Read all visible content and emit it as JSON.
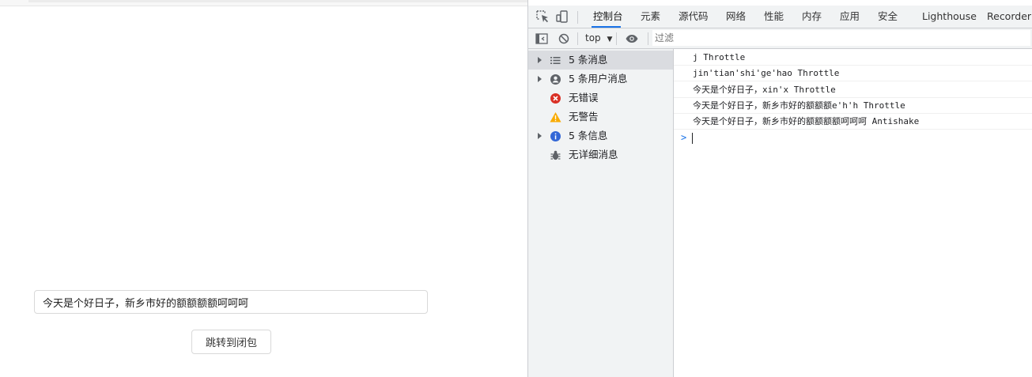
{
  "page": {
    "input_value": "今天是个好日子，新乡市好的额额额额呵呵呵",
    "jump_button_label": "跳转到闭包"
  },
  "devtools": {
    "tabs": [
      {
        "label": "控制台",
        "active": true
      },
      {
        "label": "元素"
      },
      {
        "label": "源代码"
      },
      {
        "label": "网络"
      },
      {
        "label": "性能"
      },
      {
        "label": "内存"
      },
      {
        "label": "应用"
      },
      {
        "label": "安全"
      },
      {
        "label": "Lighthouse"
      },
      {
        "label": "Recorder"
      }
    ],
    "toolbar": {
      "context": "top",
      "filter_placeholder": "过滤"
    },
    "sidebar": [
      {
        "label": "5 条消息",
        "icon": "list-icon",
        "expandable": true,
        "selected": true
      },
      {
        "label": "5 条用户消息",
        "icon": "user-icon",
        "expandable": true
      },
      {
        "label": "无错误",
        "icon": "error-icon",
        "expandable": false
      },
      {
        "label": "无警告",
        "icon": "warning-icon",
        "expandable": false
      },
      {
        "label": "5 条信息",
        "icon": "info-icon",
        "expandable": true
      },
      {
        "label": "无详细消息",
        "icon": "bug-icon",
        "expandable": false
      }
    ],
    "logs": [
      "j Throttle",
      "jin'tian'shi'ge'hao Throttle",
      "今天是个好日子，xin'x Throttle",
      "今天是个好日子，新乡市好的额额额e'h'h Throttle",
      "今天是个好日子，新乡市好的额额额额呵呵呵 Antishake"
    ]
  },
  "colors": {
    "accent": "#1a73e8",
    "error": "#d93025",
    "warning": "#f9ab00",
    "info": "#3367d6"
  }
}
